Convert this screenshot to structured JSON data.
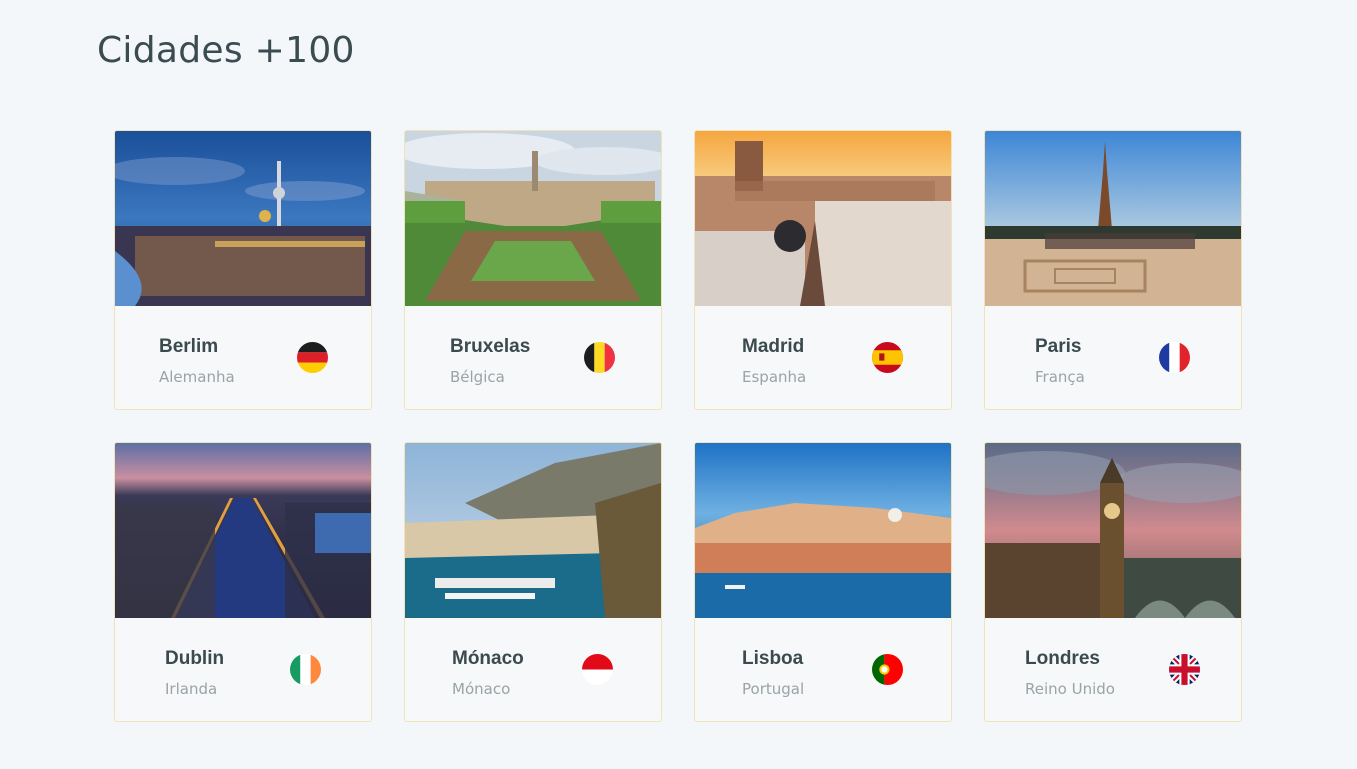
{
  "header": {
    "title": "Cidades +100"
  },
  "cities": [
    {
      "name": "Berlim",
      "country": "Alemanha",
      "flag": "germany-flag-icon"
    },
    {
      "name": "Bruxelas",
      "country": "Bélgica",
      "flag": "belgium-flag-icon"
    },
    {
      "name": "Madrid",
      "country": "Espanha",
      "flag": "spain-flag-icon"
    },
    {
      "name": "Paris",
      "country": "França",
      "flag": "france-flag-icon"
    },
    {
      "name": "Dublin",
      "country": "Irlanda",
      "flag": "ireland-flag-icon"
    },
    {
      "name": "Mónaco",
      "country": "Mónaco",
      "flag": "monaco-flag-icon"
    },
    {
      "name": "Lisboa",
      "country": "Portugal",
      "flag": "portugal-flag-icon"
    },
    {
      "name": "Londres",
      "country": "Reino Unido",
      "flag": "uk-flag-icon"
    }
  ],
  "colors": {
    "background": "#f4f7fa",
    "card_border": "#f1e2b8",
    "title_text": "#3b4c50",
    "city_text": "#3a4a4e",
    "country_text": "#9aa3a6"
  }
}
